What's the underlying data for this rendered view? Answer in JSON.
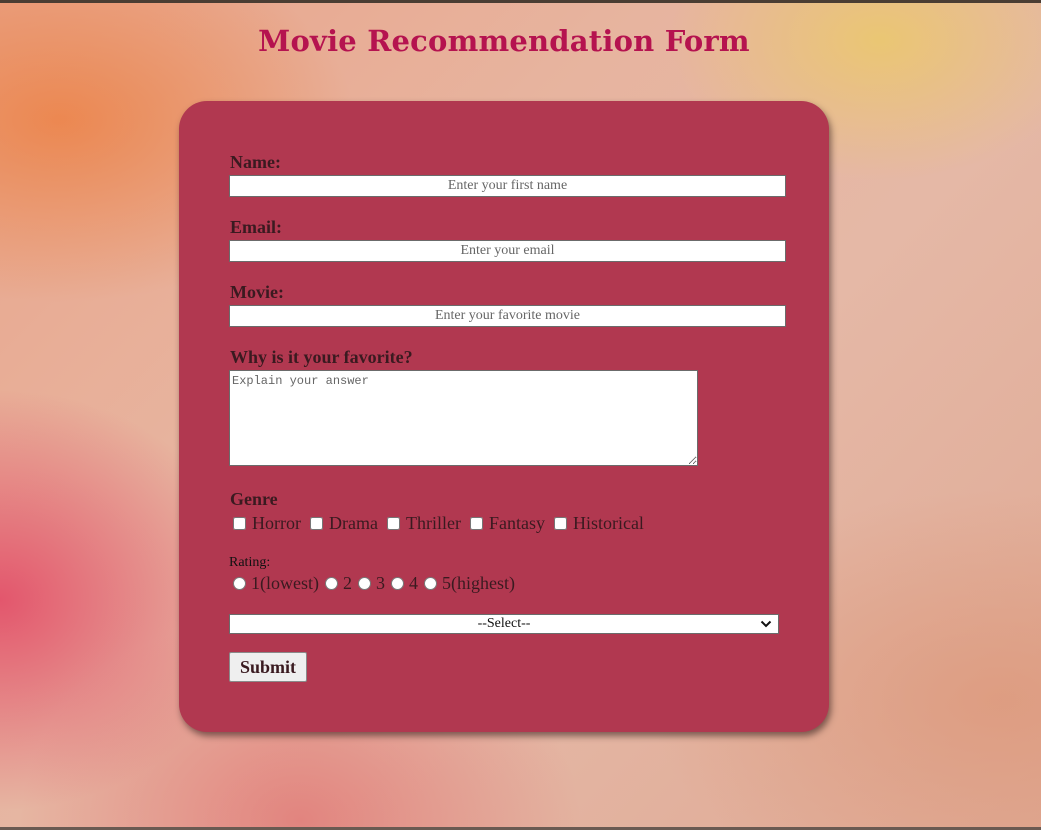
{
  "page": {
    "title": "Movie Recommendation Form"
  },
  "form": {
    "name": {
      "label": "Name:",
      "placeholder": "Enter your first name",
      "value": ""
    },
    "email": {
      "label": "Email:",
      "placeholder": "Enter your email",
      "value": ""
    },
    "movie": {
      "label": "Movie:",
      "placeholder": "Enter your favorite movie",
      "value": ""
    },
    "reason": {
      "label": "Why is it your favorite?",
      "placeholder": "Explain your answer",
      "value": ""
    },
    "genre": {
      "label": "Genre",
      "options": [
        {
          "label": "Horror",
          "checked": false
        },
        {
          "label": "Drama",
          "checked": false
        },
        {
          "label": "Thriller",
          "checked": false
        },
        {
          "label": "Fantasy",
          "checked": false
        },
        {
          "label": "Historical",
          "checked": false
        }
      ]
    },
    "rating": {
      "label": "Rating:",
      "options": [
        {
          "label": "1(lowest)",
          "checked": false
        },
        {
          "label": "2",
          "checked": false
        },
        {
          "label": "3",
          "checked": false
        },
        {
          "label": "4",
          "checked": false
        },
        {
          "label": "5(highest)",
          "checked": false
        }
      ]
    },
    "select": {
      "selected": "--Select--"
    },
    "submit_label": "Submit"
  },
  "colors": {
    "title": "#b5134f",
    "card": "#b13850",
    "label_text": "#3a1a20"
  }
}
